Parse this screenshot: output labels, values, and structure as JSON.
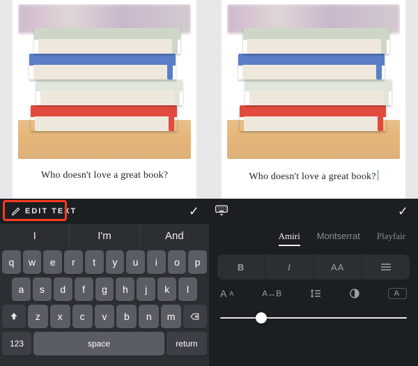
{
  "caption": "Who doesn't love a great book?",
  "left": {
    "edit_label": "EDIT TEXT",
    "suggestions": [
      "I",
      "I'm",
      "And"
    ],
    "rows": {
      "r1": [
        "q",
        "w",
        "e",
        "r",
        "t",
        "y",
        "u",
        "i",
        "o",
        "p"
      ],
      "r2": [
        "a",
        "s",
        "d",
        "f",
        "g",
        "h",
        "j",
        "k",
        "l"
      ],
      "r3": [
        "z",
        "x",
        "c",
        "v",
        "b",
        "n",
        "m"
      ]
    },
    "num_key": "123",
    "space_label": "space",
    "return_label": "return"
  },
  "right": {
    "fonts": [
      "Amiri",
      "Montserrat",
      "Playfair"
    ],
    "active_font_index": 0,
    "style_cells": [
      "B",
      "I",
      "AA",
      "≣"
    ],
    "tool_labels": {
      "size": "Aᴀ",
      "spacing": "A↔B",
      "lineheight": "↕≣",
      "contrast": "◐",
      "boxed": "A"
    },
    "slider_pct": 22
  },
  "books": {
    "covers": [
      "#cdd6c7",
      "#5a7ec8",
      "#e0e6dc",
      "#e34a3e"
    ]
  }
}
